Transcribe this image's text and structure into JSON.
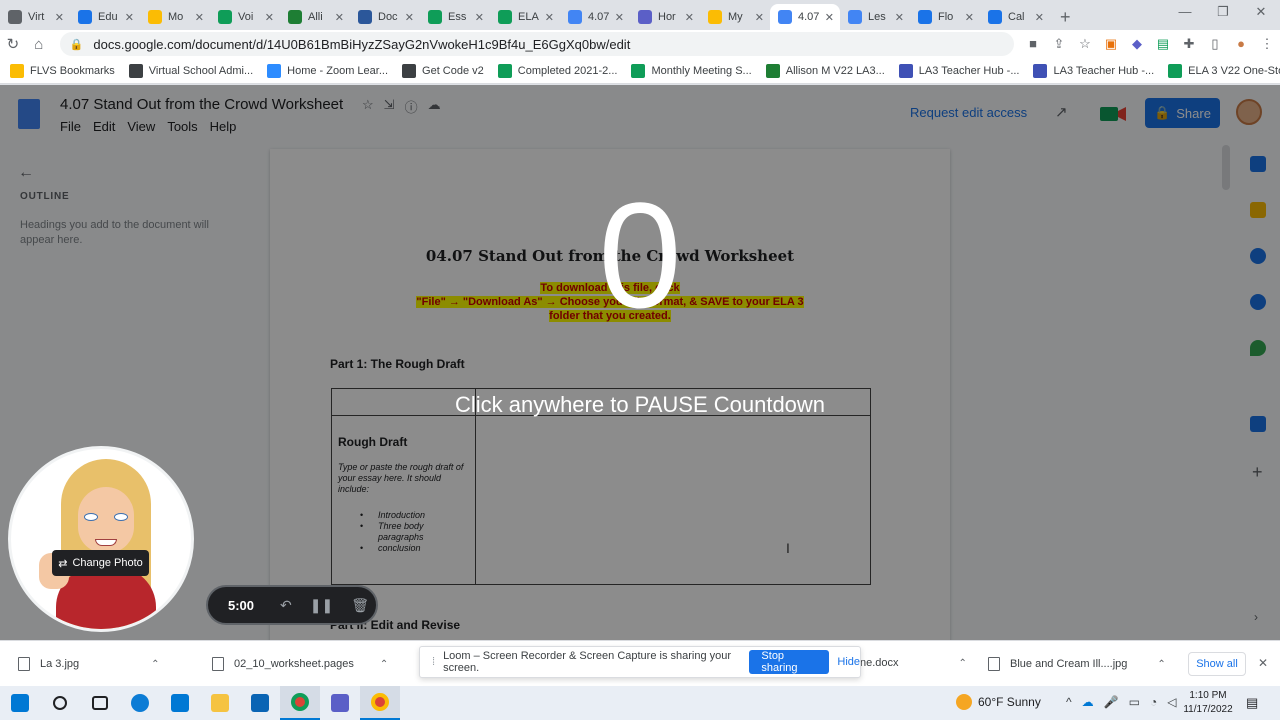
{
  "browser": {
    "tabs": [
      {
        "label": "Virt",
        "color": "#5f6368",
        "active": false
      },
      {
        "label": "Edu",
        "color": "#1a73e8",
        "active": false
      },
      {
        "label": "Mo",
        "color": "#fbbc04",
        "active": false
      },
      {
        "label": "Voi",
        "color": "#0f9d58",
        "active": false
      },
      {
        "label": "Alli",
        "color": "#1e7e34",
        "active": false
      },
      {
        "label": "Doc",
        "color": "#2b579a",
        "active": false
      },
      {
        "label": "Ess",
        "color": "#0f9d58",
        "active": false
      },
      {
        "label": "ELA",
        "color": "#0f9d58",
        "active": false
      },
      {
        "label": "4.07",
        "color": "#4285f4",
        "active": false
      },
      {
        "label": "Hor",
        "color": "#5b5fc7",
        "active": false
      },
      {
        "label": "My",
        "color": "#fbbc04",
        "active": false
      },
      {
        "label": "4.07",
        "color": "#4285f4",
        "active": true
      },
      {
        "label": "Les",
        "color": "#4285f4",
        "active": false
      },
      {
        "label": "Flo",
        "color": "#1a73e8",
        "active": false
      },
      {
        "label": "Cal",
        "color": "#1a73e8",
        "active": false
      }
    ],
    "new_tab_label": "+",
    "url": "docs.google.com/document/d/14U0B61BmBiHyzZSayG2nVwokeH1c9Bf4u_E6GgXq0bw/edit",
    "bookmarks": [
      {
        "label": "FLVS Bookmarks",
        "color": "#fbbc04"
      },
      {
        "label": "Virtual School Admi...",
        "color": "#3c4043"
      },
      {
        "label": "Home - Zoom Lear...",
        "color": "#2d8cff"
      },
      {
        "label": "Get Code v2",
        "color": "#3c4043"
      },
      {
        "label": "Completed 2021-2...",
        "color": "#0f9d58"
      },
      {
        "label": "Monthly Meeting S...",
        "color": "#0f9d58"
      },
      {
        "label": "Allison M V22 LA3...",
        "color": "#1e7e34"
      },
      {
        "label": "LA3 Teacher Hub -...",
        "color": "#3f51b5"
      },
      {
        "label": "LA3 Teacher Hub -...",
        "color": "#3f51b5"
      },
      {
        "label": "ELA 3 V22 One-Sto...",
        "color": "#0f9d58"
      }
    ]
  },
  "docs": {
    "title": "4.07 Stand Out from the Crowd Worksheet",
    "menu": [
      "File",
      "Edit",
      "View",
      "Tools",
      "Help"
    ],
    "request_access": "Request edit access",
    "share": "Share",
    "outline_heading": "OUTLINE",
    "outline_hint": "Headings you add to the document will appear here."
  },
  "document": {
    "worksheet_title": "04.07 Stand Out from the Crowd Worksheet",
    "instruction_line1": "To download this file, click",
    "instruction_line2": "\"File\" → \"Download As\" → Choose your file format, & SAVE to your ELA 3",
    "instruction_line3": "folder that you created.",
    "part1_heading": "Part 1: The Rough Draft",
    "rough_draft_label": "Rough Draft",
    "rough_draft_desc": "Type or paste the rough draft of your essay here. It should include:",
    "rough_draft_items": [
      "Introduction",
      "Three body paragraphs",
      "conclusion"
    ],
    "part2_heading": "Part II: Edit and Revise"
  },
  "loom": {
    "countdown_value": "0",
    "pause_message": "Click anywhere to PAUSE Countdown",
    "change_photo": "Change Photo",
    "timer": "5:00",
    "sharing_message": "Loom – Screen Recorder & Screen Capture is sharing your screen.",
    "stop_sharing": "Stop sharing",
    "hide": "Hide"
  },
  "downloads": {
    "items": [
      {
        "name": "La 3.jpg"
      },
      {
        "name": "02_10_worksheet.pages"
      },
      {
        "name": "ne.docx"
      },
      {
        "name": "Blue and Cream Ill....jpg"
      }
    ],
    "show_all": "Show all"
  },
  "taskbar": {
    "weather": "60°F  Sunny",
    "time": "1:10 PM",
    "date": "11/17/2022"
  }
}
